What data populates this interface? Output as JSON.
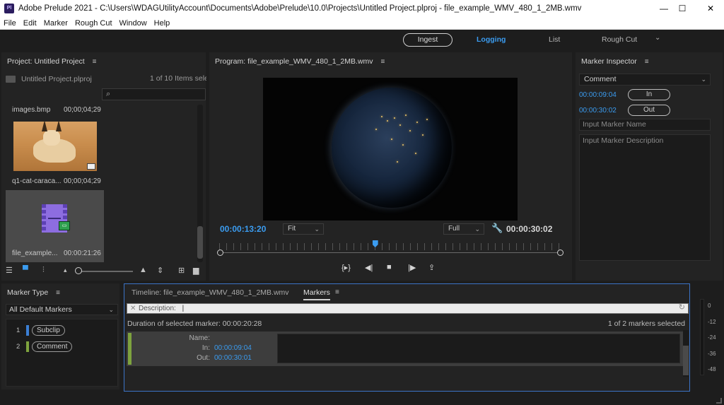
{
  "window": {
    "title": "Adobe Prelude 2021 - C:\\Users\\WDAGUtilityAccount\\Documents\\Adobe\\Prelude\\10.0\\Projects\\Untitled Project.plproj - file_example_WMV_480_1_2MB.wmv",
    "app_icon": "Pl",
    "minimize": "—",
    "maximize": "☐",
    "close": "✕"
  },
  "menu": [
    "File",
    "Edit",
    "Marker",
    "Rough Cut",
    "Window",
    "Help"
  ],
  "workspaces": {
    "ingest": "Ingest",
    "logging": "Logging",
    "list": "List",
    "rough_cut": "Rough Cut",
    "more": "⌄"
  },
  "project": {
    "title": "Project: Untitled Project",
    "menu_icon": "≡",
    "file": "Untitled Project.plproj",
    "count": "1 of 10 Items selec",
    "search_icon": "⌕",
    "clips": [
      {
        "name": "images.bmp",
        "duration": "00;00;04;29"
      },
      {
        "name": "q1-cat-caraca...",
        "duration": "00;00;04;29"
      },
      {
        "name": "file_example...",
        "duration": "00:00:21:26"
      }
    ]
  },
  "program": {
    "title": "Program: file_example_WMV_480_1_2MB.wmv",
    "menu_icon": "≡",
    "current_time": "00:00:13:20",
    "zoom": "Fit",
    "resolution": "Full",
    "duration": "00:00:30:02",
    "playhead_fraction": 0.455,
    "transport": {
      "step_in": "{▸}",
      "prev_frame": "◀|",
      "stop": "■",
      "next_frame": "|▶",
      "export": "⇪"
    }
  },
  "inspector": {
    "title": "Marker Inspector",
    "menu_icon": "≡",
    "type": "Comment",
    "in_time": "00:00:09:04",
    "in_label": "In",
    "out_time": "00:00:30:02",
    "out_label": "Out",
    "name_placeholder": "Input Marker Name",
    "desc_placeholder": "Input Marker Description"
  },
  "marker_type": {
    "title": "Marker Type",
    "menu_icon": "≡",
    "filter": "All Default Markers",
    "items": [
      {
        "num": "1",
        "label": "Subclip",
        "color": "#3b7fd4"
      },
      {
        "num": "2",
        "label": "Comment",
        "color": "#7ea33e"
      }
    ]
  },
  "markers": {
    "timeline_tab": "Timeline: file_example_WMV_480_1_2MB.wmv",
    "markers_tab": "Markers",
    "menu_icon": "≡",
    "desc_filter": "Description:",
    "duration_text": "Duration of selected marker: 00:00:20:28",
    "selection_count": "1 of 2 markers selected",
    "row": {
      "name_label": "Name:",
      "in_label": "In:",
      "in_value": "00:00:09:04",
      "out_label": "Out:",
      "out_value": "00:00:30:01"
    }
  },
  "audio_meter": {
    "ticks": [
      "0",
      "-12",
      "-24",
      "-36",
      "-48"
    ]
  },
  "colors": {
    "accent": "#3b9cf0",
    "subclip": "#3b7fd4",
    "comment": "#7ea33e",
    "panel_bg": "#232323"
  }
}
